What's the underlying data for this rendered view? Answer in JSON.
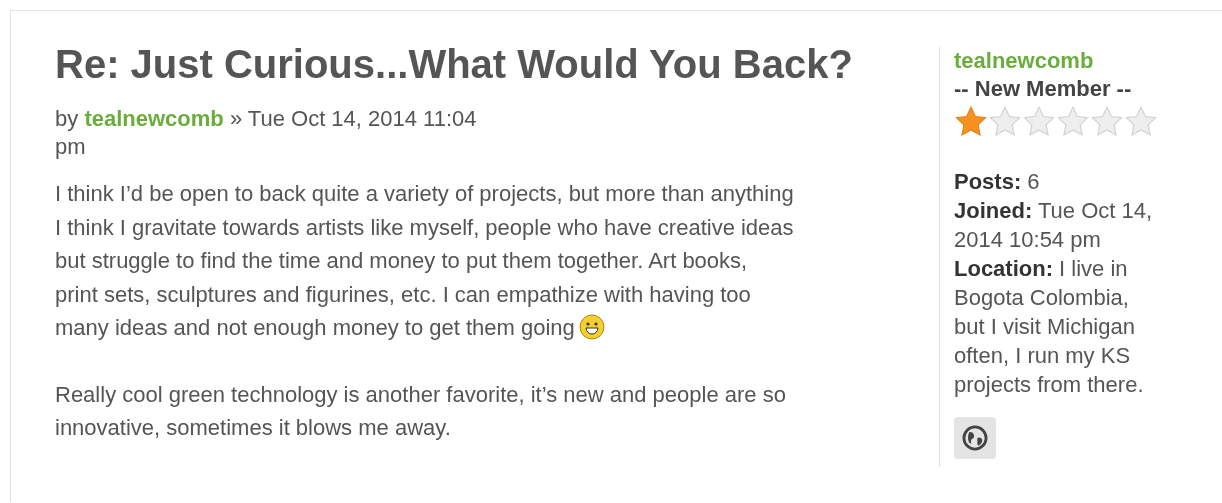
{
  "post": {
    "title": "Re: Just Curious...What Would You Back?",
    "byline": {
      "prefix": "by",
      "author": "tealnewcomb",
      "date": "» Tue Oct 14, 2014 11:04 pm"
    },
    "paragraphs": [
      {
        "text": "I think I’d be open to back quite a variety of projects, but more than anything I think I gravitate towards artists like myself, people who have creative ideas but struggle to find the time and money to put them together. Art books, print sets, sculptures and figurines, etc. I can empathize with having too many ideas and not enough money to get them going",
        "smiley": true
      },
      {
        "text": "Really cool green technology is another favorite, it’s new and people are so innovative, sometimes it blows me away."
      }
    ]
  },
  "profile": {
    "username": "tealnewcomb",
    "rank": "-- New Member --",
    "stars": 1,
    "fields": [
      "**Posts:** 6",
      "**Joined:** Tue Oct 14, 2014 10:54 pm",
      "**Location:** I live in Bogota Colombia, but I visit Michigan often, I run my KS projects from there."
    ]
  }
}
